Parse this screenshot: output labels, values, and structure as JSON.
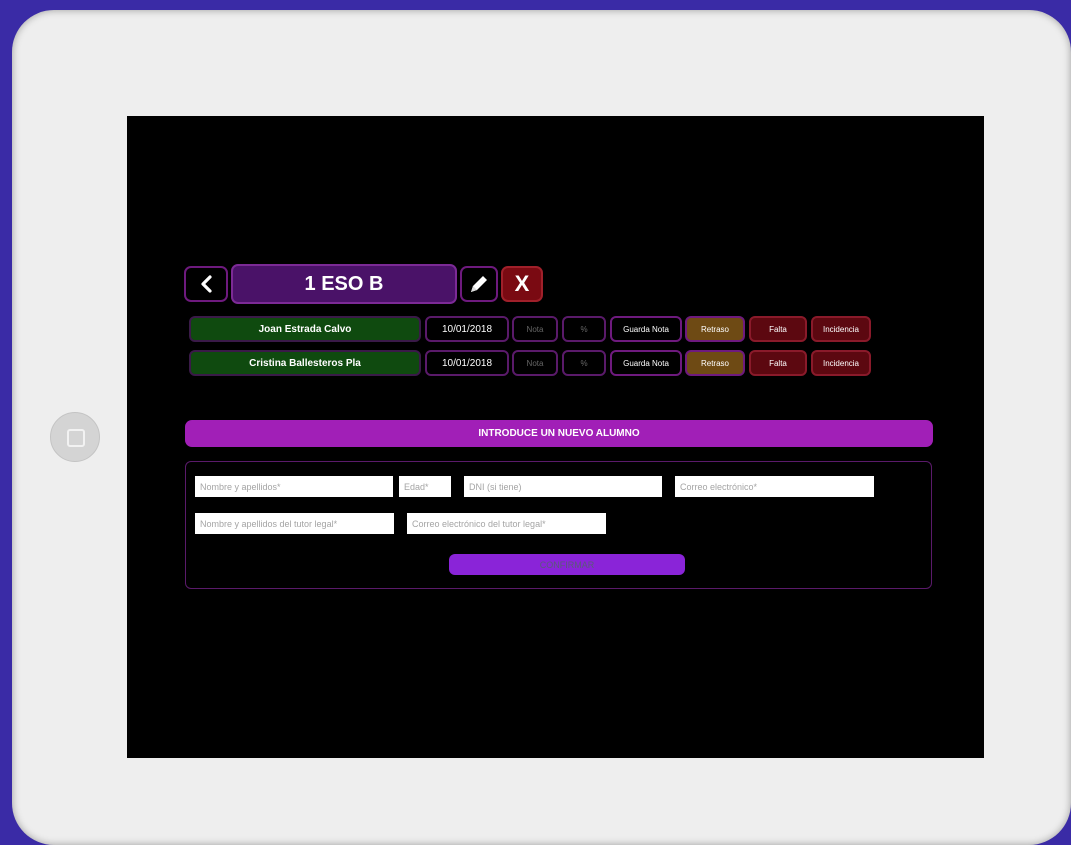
{
  "header": {
    "title": "1 ESO B",
    "back_icon": "chevron-left-icon",
    "edit_icon": "pencil-icon",
    "close_label": "X"
  },
  "students": [
    {
      "name": "Joan Estrada Calvo",
      "date": "10/01/2018",
      "nota_placeholder": "Nota",
      "pct_placeholder": "%",
      "save_label": "Guarda Nota",
      "retraso_label": "Retraso",
      "falta_label": "Falta",
      "incidencia_label": "Incidencia"
    },
    {
      "name": "Cristina Ballesteros Pla",
      "date": "10/01/2018",
      "nota_placeholder": "Nota",
      "pct_placeholder": "%",
      "save_label": "Guarda Nota",
      "retraso_label": "Retraso",
      "falta_label": "Falta",
      "incidencia_label": "Incidencia"
    }
  ],
  "new_student": {
    "banner": "INTRODUCE UN NUEVO ALUMNO",
    "name_placeholder": "Nombre y apellidos*",
    "age_placeholder": "Edad*",
    "dni_placeholder": "DNI (si tiene)",
    "email_placeholder": "Correo electrónico*",
    "tutor_name_placeholder": "Nombre y apellidos del tutor legal*",
    "tutor_email_placeholder": "Correo electrónico del tutor legal*",
    "confirm_label": "CONFIRMAR"
  },
  "colors": {
    "background": "#3a2ba6",
    "accent_purple": "#a11fb7",
    "title_purple": "#4a1268",
    "name_green": "#0f4a0f",
    "danger_red": "#7a0a12",
    "retraso_brown": "#6e4a14",
    "confirm_violet": "#8a24d8"
  }
}
